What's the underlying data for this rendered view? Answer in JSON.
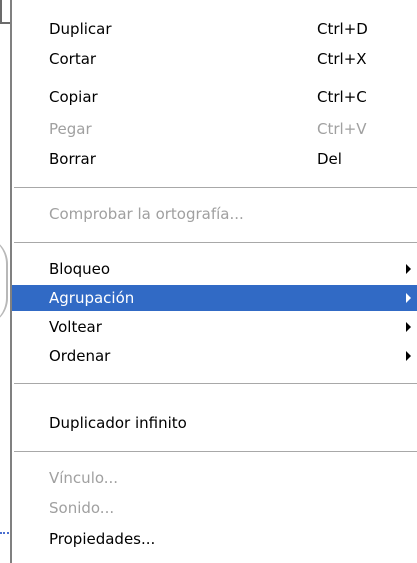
{
  "menu": {
    "groups": [
      {
        "items": [
          {
            "label": "Duplicar",
            "shortcut": "Ctrl+D",
            "enabled": true
          },
          {
            "label": "Cortar",
            "shortcut": "Ctrl+X",
            "enabled": true
          },
          {
            "label": "Copiar",
            "shortcut": "Ctrl+C",
            "enabled": true
          },
          {
            "label": "Pegar",
            "shortcut": "Ctrl+V",
            "enabled": false
          },
          {
            "label": "Borrar",
            "shortcut": "Del",
            "enabled": true
          }
        ]
      },
      {
        "items": [
          {
            "label": "Comprobar la ortografía...",
            "enabled": false
          }
        ]
      },
      {
        "items": [
          {
            "label": "Bloqueo",
            "enabled": true,
            "submenu": true
          },
          {
            "label": "Agrupación",
            "enabled": true,
            "submenu": true,
            "selected": true
          },
          {
            "label": "Voltear",
            "enabled": true,
            "submenu": true
          },
          {
            "label": "Ordenar",
            "enabled": true,
            "submenu": true
          }
        ]
      },
      {
        "items": [
          {
            "label": "Duplicador infinito",
            "enabled": true
          }
        ]
      },
      {
        "items": [
          {
            "label": "Vínculo...",
            "enabled": false
          },
          {
            "label": "Sonido...",
            "enabled": false
          },
          {
            "label": "Propiedades...",
            "enabled": true
          }
        ]
      }
    ]
  },
  "colors": {
    "highlight": "#316ac5",
    "disabled_text": "#a0a0a0",
    "text": "#000000"
  },
  "icons": {
    "submenu": "chevron-right-icon"
  }
}
